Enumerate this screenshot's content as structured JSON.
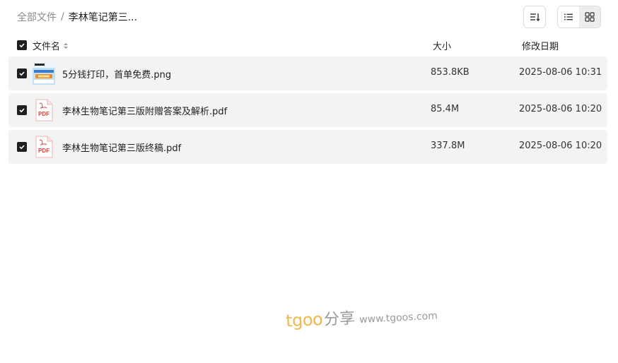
{
  "breadcrumb": {
    "root": "全部文件",
    "separator": "/",
    "current": "李林笔记第三..."
  },
  "toolbar": {
    "sort_icon": "sort-icon",
    "list_view_icon": "list-view-icon",
    "grid_view_icon": "grid-view-icon"
  },
  "columns": {
    "name": "文件名",
    "size": "大小",
    "date": "修改日期"
  },
  "files": [
    {
      "name": "5分钱打印，首单免费.png",
      "size": "853.8KB",
      "date": "2025-08-06 10:31",
      "type": "image",
      "checked": true
    },
    {
      "name": "李林生物笔记第三版附赠答案及解析.pdf",
      "size": "85.4M",
      "date": "2025-08-06 10:20",
      "type": "pdf",
      "checked": true
    },
    {
      "name": "李林生物笔记第三版终稿.pdf",
      "size": "337.8M",
      "date": "2025-08-06 10:20",
      "type": "pdf",
      "checked": true
    }
  ],
  "pdf_icon_label": "PDF",
  "watermark": {
    "logo": "tgoo",
    "cn": "分享",
    "url": "www.tgoos.com"
  },
  "colors": {
    "row_bg": "#f3f3f3",
    "checkbox": "#1f1f1f",
    "pdf_red": "#e0463f",
    "watermark_orange": "#f2b64b"
  }
}
